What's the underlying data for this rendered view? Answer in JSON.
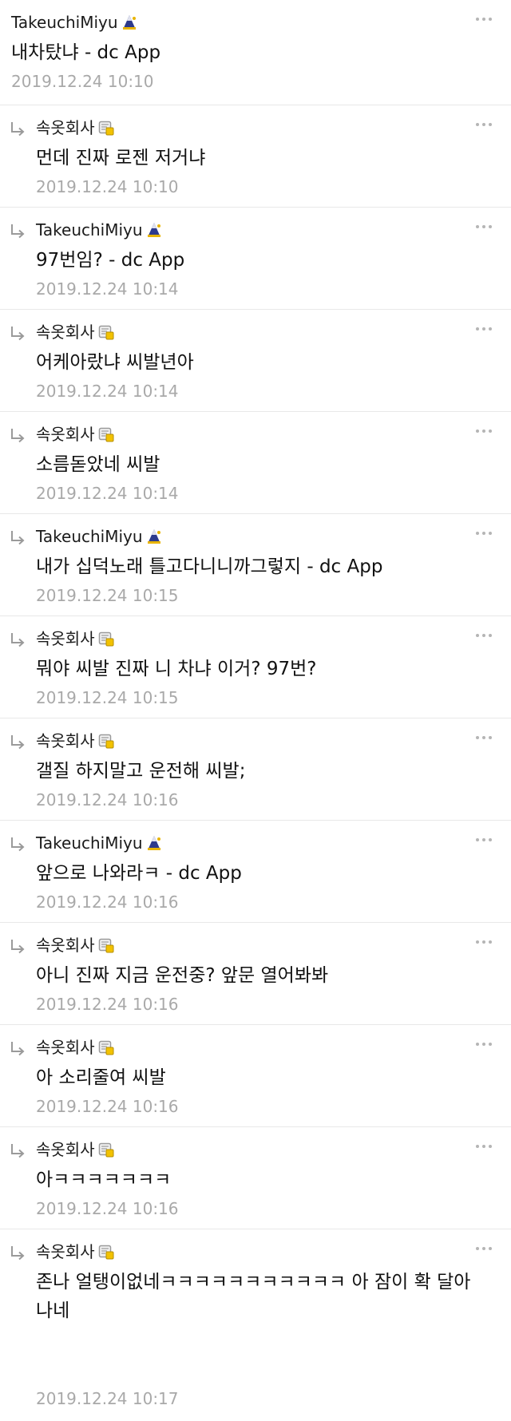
{
  "comments": [
    {
      "nick": "TakeuchiMiyu",
      "badge": "gallog-fixed-nick-icon",
      "text": "내차탔냐  - dc App",
      "time": "2019.12.24 10:10",
      "reply": false
    },
    {
      "nick": "속옷회사",
      "badge": "gallog-nick-icon",
      "text": "먼데 진짜 로젠 저거냐",
      "time": "2019.12.24 10:10",
      "reply": true
    },
    {
      "nick": "TakeuchiMiyu",
      "badge": "gallog-fixed-nick-icon",
      "text": "97번임?  - dc App",
      "time": "2019.12.24 10:14",
      "reply": true
    },
    {
      "nick": "속옷회사",
      "badge": "gallog-nick-icon",
      "text": "어케아랐냐 씨발년아",
      "time": "2019.12.24 10:14",
      "reply": true
    },
    {
      "nick": "속옷회사",
      "badge": "gallog-nick-icon",
      "text": "소름돋았네 씨발",
      "time": "2019.12.24 10:14",
      "reply": true
    },
    {
      "nick": "TakeuchiMiyu",
      "badge": "gallog-fixed-nick-icon",
      "text": "내가 십덕노래 틀고다니니까그렇지  - dc App",
      "time": "2019.12.24 10:15",
      "reply": true
    },
    {
      "nick": "속옷회사",
      "badge": "gallog-nick-icon",
      "text": "뭐야 씨발 진짜 니 차냐 이거? 97번?",
      "time": "2019.12.24 10:15",
      "reply": true
    },
    {
      "nick": "속옷회사",
      "badge": "gallog-nick-icon",
      "text": "갤질 하지말고 운전해 씨발;",
      "time": "2019.12.24 10:16",
      "reply": true
    },
    {
      "nick": "TakeuchiMiyu",
      "badge": "gallog-fixed-nick-icon",
      "text": "앞으로 나와라ㅋ  - dc App",
      "time": "2019.12.24 10:16",
      "reply": true
    },
    {
      "nick": "속옷회사",
      "badge": "gallog-nick-icon",
      "text": "아니 진짜 지금 운전중? 앞문 열어봐봐",
      "time": "2019.12.24 10:16",
      "reply": true
    },
    {
      "nick": "속옷회사",
      "badge": "gallog-nick-icon",
      "text": "아 소리줄여 씨발",
      "time": "2019.12.24 10:16",
      "reply": true
    },
    {
      "nick": "속옷회사",
      "badge": "gallog-nick-icon",
      "text": "아ㅋㅋㅋㅋㅋㅋㅋ",
      "time": "2019.12.24 10:16",
      "reply": true
    },
    {
      "nick": "속옷회사",
      "badge": "gallog-nick-icon",
      "text": "존나 얼탱이없네ㅋㅋㅋㅋㅋㅋㅋㅋㅋㅋㅋ 아 잠이 확 달아나네",
      "time": "2019.12.24 10:17",
      "reply": true
    }
  ],
  "more_icon": "more-dots-icon",
  "reply_icon": "reply-arrow-icon",
  "colors": {
    "text": "#1a1a1a",
    "timestamp": "#a9a9a9",
    "divider": "#e8e8e8",
    "fixed_badge_blue": "#2d3a8c",
    "fixed_badge_gold": "#e8b400",
    "nick_badge_gray": "#9a9a9a",
    "nick_badge_yellow": "#f2c200"
  }
}
